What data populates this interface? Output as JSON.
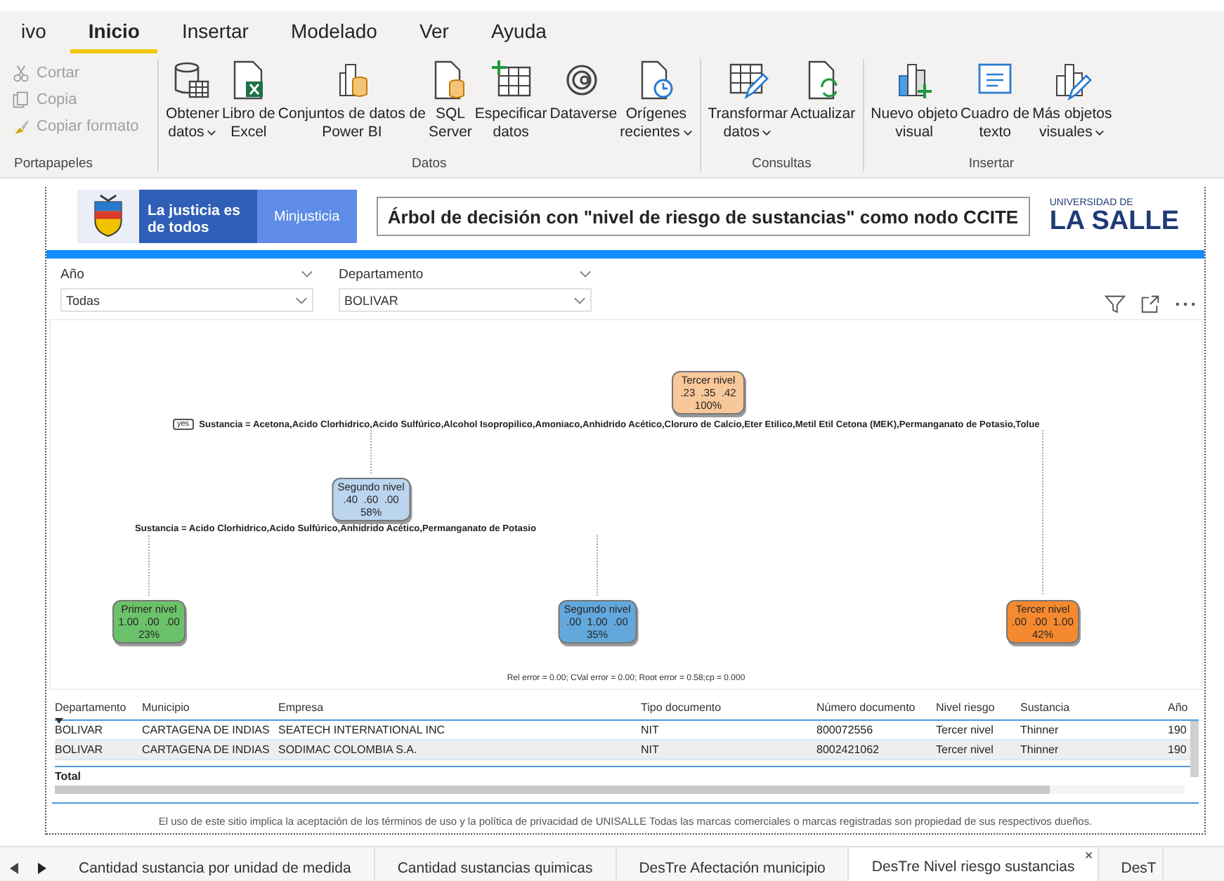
{
  "ribbon": {
    "tabs": [
      {
        "label": "ivo",
        "selected": false
      },
      {
        "label": "Inicio",
        "selected": true
      },
      {
        "label": "Insertar",
        "selected": false
      },
      {
        "label": "Modelado",
        "selected": false
      },
      {
        "label": "Ver",
        "selected": false
      },
      {
        "label": "Ayuda",
        "selected": false
      }
    ],
    "groups": [
      {
        "name": "Portapapeles",
        "kind": "stack",
        "items": [
          {
            "lines": [
              "Cortar"
            ],
            "disabled": true
          },
          {
            "lines": [
              "Copia"
            ],
            "disabled": true
          },
          {
            "lines": [
              "Copiar formato"
            ],
            "disabled": true
          }
        ]
      },
      {
        "name": "Datos",
        "kind": "large",
        "items": [
          {
            "lines": [
              "Obtener",
              "datos"
            ],
            "dropdown": true
          },
          {
            "lines": [
              "Libro de",
              "Excel"
            ],
            "dropdown": false
          },
          {
            "lines": [
              "Conjuntos de datos de",
              "Power BI"
            ],
            "dropdown": false
          },
          {
            "lines": [
              "SQL",
              "Server"
            ],
            "dropdown": false
          },
          {
            "lines": [
              "Especificar",
              "datos"
            ],
            "dropdown": false
          },
          {
            "lines": [
              "Dataverse"
            ],
            "dropdown": false
          },
          {
            "lines": [
              "Orígenes",
              "recientes"
            ],
            "dropdown": true
          }
        ]
      },
      {
        "name": "Consultas",
        "kind": "large",
        "items": [
          {
            "lines": [
              "Transformar",
              "datos"
            ],
            "dropdown": true
          },
          {
            "lines": [
              "Actualizar"
            ],
            "dropdown": false
          }
        ]
      },
      {
        "name": "Insertar",
        "kind": "large",
        "items": [
          {
            "lines": [
              "Nuevo objeto",
              "visual"
            ],
            "dropdown": false
          },
          {
            "lines": [
              "Cuadro de",
              "texto"
            ],
            "dropdown": false
          },
          {
            "lines": [
              "Más objetos",
              "visuales"
            ],
            "dropdown": true
          }
        ]
      }
    ]
  },
  "header": {
    "slogan": "La justicia es de todos",
    "ministry": "Minjusticia",
    "title": "Árbol de decisión con \"nivel de riesgo de sustancias\" como nodo CCITE",
    "university_small": "UNIVERSIDAD DE",
    "university_name": "LA SALLE"
  },
  "slicers": [
    {
      "label": "Año",
      "value": "Todas"
    },
    {
      "label": "Departamento",
      "value": "BOLIVAR"
    }
  ],
  "tree": {
    "nodes": [
      {
        "class": "Tercer nivel",
        "probs": ".23  .35  .42",
        "share": "100%",
        "color": "#f8c79a"
      },
      {
        "class": "Segundo nivel",
        "probs": ".40  .60  .00",
        "share": "58%",
        "color": "#bcd5ef"
      },
      {
        "class": "Primer nivel",
        "probs": "1.00  .00  .00",
        "share": "23%",
        "color": "#6cc26a"
      },
      {
        "class": "Segundo nivel",
        "probs": ".00  1.00  .00",
        "share": "35%",
        "color": "#62a8dc"
      },
      {
        "class": "Tercer nivel",
        "probs": ".00  .00  1.00",
        "share": "42%",
        "color": "#f5892f"
      }
    ],
    "splits": [
      {
        "tag": "yes",
        "rule": "Sustancia = Acetona,Acido Clorhidrico,Acido Sulfúrico,Alcohol Isopropilico,Amoniaco,Anhidrido Acético,Cloruro de Calcio,Eter Etilico,Metil Etil Cetona (MEK),Permanganato de Potasio,Tolue"
      },
      {
        "rule": "Sustancia = Acido Clorhidrico,Acido Sulfúrico,Anhidrido Acético,Permanganato de Potasio"
      }
    ],
    "footnote": "Rel error = 0.00; CVal error = 0.00; Root error = 0.58;cp = 0.000"
  },
  "table": {
    "columns": [
      "Departamento",
      "Municipio",
      "Empresa",
      "Tipo documento",
      "Número documento",
      "Nivel riesgo",
      "Sustancia",
      "Año"
    ],
    "rows": [
      [
        "BOLIVAR",
        "CARTAGENA DE INDIAS",
        "SEATECH INTERNATIONAL INC",
        "NIT",
        "800072556",
        "Tercer nivel",
        "Thinner",
        "190"
      ],
      [
        "BOLIVAR",
        "CARTAGENA DE INDIAS",
        "SODIMAC COLOMBIA S.A.",
        "NIT",
        "8002421062",
        "Tercer nivel",
        "Thinner",
        "190"
      ]
    ],
    "total_label": "Total"
  },
  "footer": "El uso de este sitio implica la aceptación de los términos de uso y la política de privacidad de UNISALLE Todas las marcas comerciales o marcas registradas son propiedad de sus respectivos dueños.",
  "page_tabs": [
    {
      "label": "Cantidad sustancia por unidad de medida",
      "selected": false
    },
    {
      "label": "Cantidad sustancias quimicas",
      "selected": false
    },
    {
      "label": "DesTre Afectación municipio",
      "selected": false
    },
    {
      "label": "DesTre Nivel riesgo sustancias",
      "selected": true,
      "close": "×"
    },
    {
      "label": "DesT",
      "selected": false
    }
  ]
}
